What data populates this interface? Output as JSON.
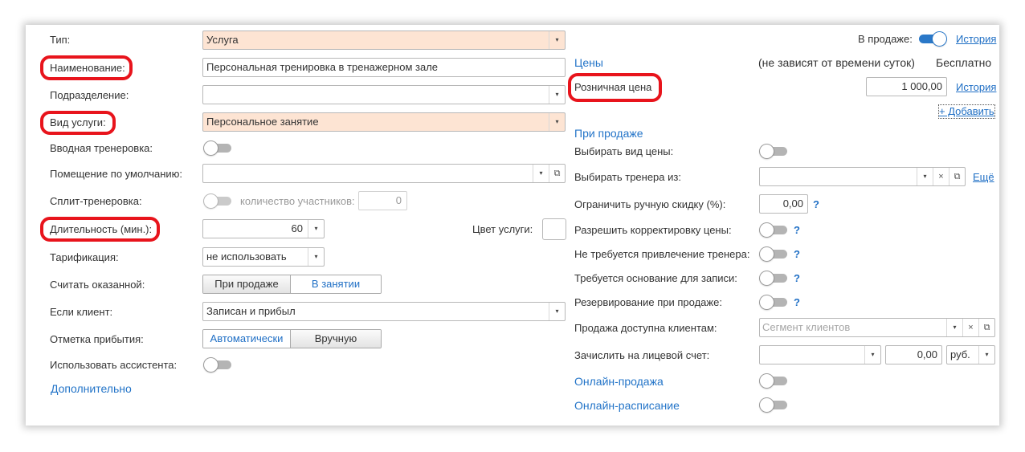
{
  "left": {
    "type": {
      "label": "Тип:",
      "value": "Услуга"
    },
    "name": {
      "label": "Наименование:",
      "value": "Персональная тренировка в тренажерном зале"
    },
    "division": {
      "label": "Подразделение:",
      "value": ""
    },
    "service_kind": {
      "label": "Вид услуги:",
      "value": "Персональное занятие"
    },
    "intro_training": {
      "label": "Вводная тренеровка:",
      "on": false
    },
    "default_room": {
      "label": "Помещение по умолчанию:",
      "value": ""
    },
    "split_training": {
      "label": "Сплит-тренеровка:",
      "on": false,
      "participants_label": "количество участников:",
      "participants_value": "0"
    },
    "duration": {
      "label": "Длительность (мин.):",
      "value": "60"
    },
    "service_color": {
      "label": "Цвет услуги:"
    },
    "tariffing": {
      "label": "Тарификация:",
      "value": "не использовать"
    },
    "count_rendered": {
      "label": "Считать оказанной:",
      "options": [
        "При продаже",
        "В занятии"
      ],
      "selected": 0
    },
    "if_client": {
      "label": "Если клиент:",
      "value": "Записан и прибыл"
    },
    "arrival_mark": {
      "label": "Отметка прибытия:",
      "options": [
        "Автоматически",
        "Вручную"
      ],
      "selected": 1
    },
    "use_assistant": {
      "label": "Использовать ассистента:",
      "on": false
    },
    "additional_link": "Дополнительно"
  },
  "right": {
    "on_sale": {
      "label": "В продаже:",
      "on": true,
      "history_link": "История"
    },
    "prices": {
      "section": "Цены",
      "note": "(не зависят от времени суток)",
      "free_label": "Бесплатно",
      "retail_label": "Розничная цена",
      "retail_value": "1 000,00",
      "history_link": "История",
      "add_link": "+ Добавить"
    },
    "on_sale_section": "При продаже",
    "choose_price_kind": {
      "label": "Выбирать вид цены:",
      "on": false
    },
    "choose_trainer": {
      "label": "Выбирать тренера из:",
      "value": "",
      "more_link": "Ещё"
    },
    "limit_discount": {
      "label": "Ограничить ручную скидку (%):",
      "value": "0,00",
      "help": "?"
    },
    "allow_price_adjust": {
      "label": "Разрешить корректировку цены:",
      "on": false,
      "help": "?"
    },
    "no_trainer_needed": {
      "label": "Не требуется привлечение тренера:",
      "on": false,
      "help": "?"
    },
    "basis_required": {
      "label": "Требуется основание для записи:",
      "on": false,
      "help": "?"
    },
    "reserve_on_sale": {
      "label": "Резервирование при продаже:",
      "on": false,
      "help": "?"
    },
    "available_to_clients": {
      "label": "Продажа доступна клиентам:",
      "placeholder": "Сегмент клиентов"
    },
    "credit_account": {
      "label": "Зачислить на лицевой счет:",
      "account": "",
      "amount": "0,00",
      "currency": "руб."
    },
    "online_sale": {
      "label": "Онлайн-продажа",
      "on": false
    },
    "online_schedule": {
      "label": "Онлайн-расписание",
      "on": false
    }
  },
  "icons": {
    "dropdown": "▾",
    "open": "⧉",
    "clear": "×"
  },
  "colors": {
    "highlight_ring": "#e8141c",
    "link": "#1f6fc5",
    "required_field_bg": "#fde4d3",
    "toggle_on": "#2a78c8"
  }
}
